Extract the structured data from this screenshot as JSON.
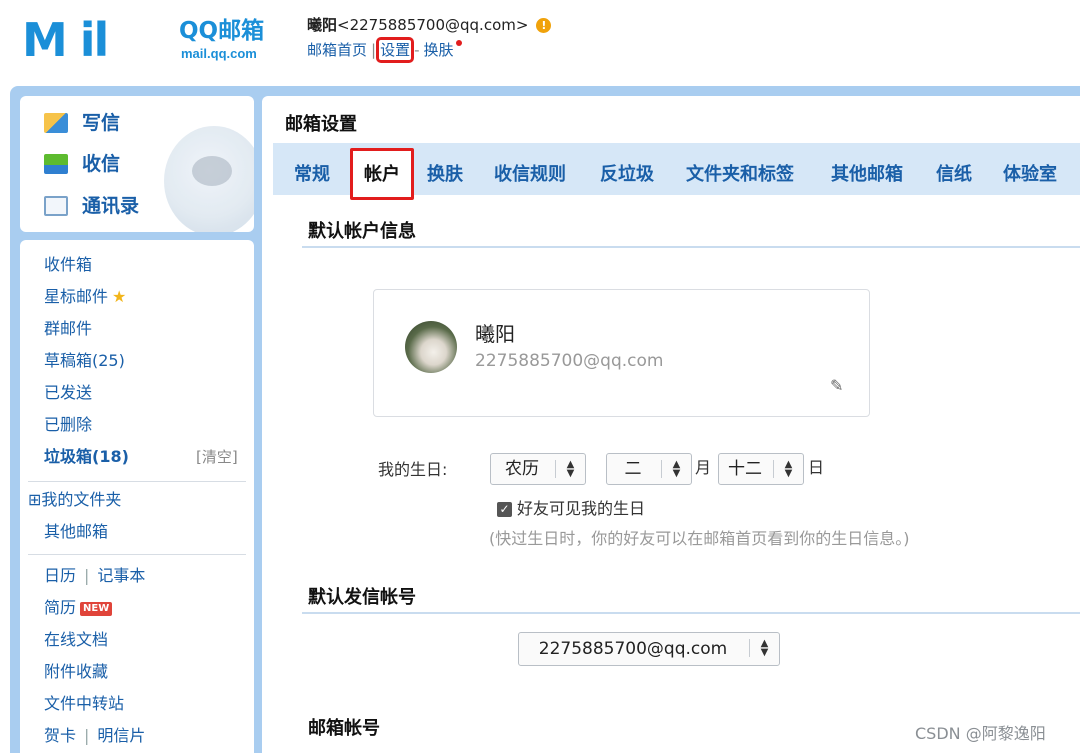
{
  "header": {
    "logo_text": "M il",
    "logo_brand": "QQ邮箱",
    "logo_url": "mail.qq.com",
    "user_name": "曦阳",
    "user_email": "<2275885700@qq.com>",
    "links": {
      "home": "邮箱首页",
      "settings": "设置",
      "skin": "换肤"
    }
  },
  "sidebar": {
    "actions": {
      "compose": "写信",
      "inbox": "收信",
      "contacts": "通讯录"
    },
    "folders": {
      "inbox": "收件箱",
      "starred": "星标邮件",
      "group": "群邮件",
      "drafts": "草稿箱(25)",
      "sent": "已发送",
      "deleted": "已删除",
      "spam": "垃圾箱(18)",
      "clear": "[清空]",
      "my_folders": "⊞我的文件夹",
      "other_mailbox": "其他邮箱"
    },
    "tools": {
      "calendar": "日历",
      "notes": "记事本",
      "resume": "简历",
      "new_badge": "NEW",
      "docs": "在线文档",
      "attachments": "附件收藏",
      "transfer": "文件中转站",
      "cards": "贺卡",
      "postcards": "明信片"
    }
  },
  "main": {
    "title": "邮箱设置",
    "tabs": [
      "常规",
      "帐户",
      "换肤",
      "收信规则",
      "反垃圾",
      "文件夹和标签",
      "其他邮箱",
      "信纸",
      "体验室"
    ],
    "active_tab": "帐户",
    "sections": {
      "default_account": "默认帐户信息",
      "default_sender": "默认发信帐号",
      "mailbox_account": "邮箱帐号"
    },
    "profile": {
      "name": "曦阳",
      "email": "2275885700@qq.com"
    },
    "birthday": {
      "label": "我的生日:",
      "calendar_type": "农历",
      "month": "二",
      "month_unit": "月",
      "day": "十二",
      "day_unit": "日",
      "share_label": "好友可见我的生日",
      "share_checked": true,
      "hint": "(快过生日时，你的好友可以在邮箱首页看到你的生日信息。)"
    },
    "sender_select": "2275885700@qq.com"
  },
  "watermark": "CSDN @阿黎逸阳",
  "colors": {
    "link": "#1a5fa8",
    "accent": "#1b8fd8",
    "highlight": "#e21d1d",
    "frame": "#a9cdf0"
  }
}
